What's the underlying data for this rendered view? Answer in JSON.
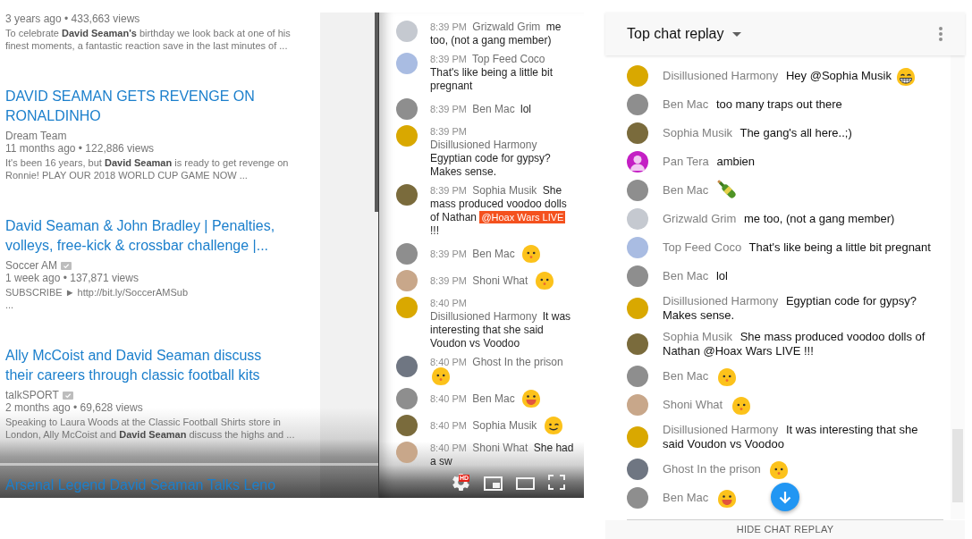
{
  "video_frame": {
    "results": [
      {
        "meta": "3 years ago • 433,663 views",
        "description": [
          "To celebrate **David Seaman's** birthday we look back at one of his",
          "finest moments, a fantastic reaction save in the last minutes of ..."
        ]
      },
      {
        "title": "DAVID SEAMAN GETS REVENGE ON RONALDINHO",
        "channel": "Dream Team",
        "verified": false,
        "meta": "11 months ago • 122,886 views",
        "description": [
          "It's been 16 years, but **David Seaman** is ready to get revenge on",
          "Ronnie! PLAY OUR 2018 WORLD CUP GAME NOW ..."
        ]
      },
      {
        "title": "David Seaman & John Bradley | Penalties, volleys, free-kick & crossbar challenge |...",
        "channel": "Soccer AM",
        "verified": true,
        "meta": "1 week ago • 137,871 views",
        "description": [
          "SUBSCRIBE ► http://bit.ly/SoccerAMSub",
          "..."
        ]
      },
      {
        "title": "Ally McCoist and David Seaman discuss their careers through classic football kits",
        "channel": "talkSPORT",
        "verified": true,
        "meta": "2 months ago • 69,628 views",
        "description": [
          "Speaking to Laura Woods at the Classic Football Shirts store in",
          "London, Ally McCoist and **David Seaman** discuss the highs and ..."
        ]
      },
      {
        "title": "Arsenal Legend David Seaman Talks Leno"
      }
    ],
    "chat": {
      "messages": [
        {
          "time": "8:39 PM",
          "author": "Grizwald Grim",
          "avatar": {
            "kind": "picture",
            "color": "#c5c9d0"
          },
          "segments": [
            {
              "kind": "text",
              "text": "me too, (not a gang member)"
            }
          ]
        },
        {
          "time": "8:39 PM",
          "author": "Top Feed Coco",
          "avatar": {
            "kind": "picture",
            "color": "#a9bce2"
          },
          "segments": [
            {
              "kind": "text",
              "text": "That's like being a little bit pregnant"
            }
          ]
        },
        {
          "time": "8:39 PM",
          "author": "Ben Mac",
          "avatar": {
            "kind": "picture",
            "color": "#8e8e8e"
          },
          "segments": [
            {
              "kind": "text",
              "text": "lol"
            }
          ]
        },
        {
          "time": "8:39 PM",
          "author": "Disillusioned Harmony",
          "avatar": {
            "kind": "picture",
            "color": "#d9a800"
          },
          "segments": [
            {
              "kind": "text",
              "text": "Egyptian code for gypsy? Makes sense."
            }
          ]
        },
        {
          "time": "8:39 PM",
          "author": "Sophia Musik",
          "avatar": {
            "kind": "picture",
            "color": "#7a6b3c"
          },
          "segments": [
            {
              "kind": "text",
              "text": "She mass produced voodoo dolls of Nathan"
            },
            {
              "kind": "mention",
              "text": "@Hoax Wars LIVE"
            },
            {
              "kind": "text",
              "text": "!!!"
            }
          ]
        },
        {
          "time": "8:39 PM",
          "author": "Ben Mac",
          "avatar": {
            "kind": "picture",
            "color": "#8e8e8e"
          },
          "segments": [
            {
              "kind": "hushed"
            }
          ]
        },
        {
          "time": "8:39 PM",
          "author": "Shoni What",
          "avatar": {
            "kind": "picture",
            "color": "#c8a78a"
          },
          "segments": [
            {
              "kind": "hushed"
            }
          ]
        },
        {
          "time": "8:40 PM",
          "author": "Disillusioned Harmony",
          "avatar": {
            "kind": "picture",
            "color": "#d9a800"
          },
          "segments": [
            {
              "kind": "text",
              "text": "It was interesting that she said Voudon vs Voodoo"
            }
          ]
        },
        {
          "time": "8:40 PM",
          "author": "Ghost In the prison",
          "avatar": {
            "kind": "picture",
            "color": "#6f7682"
          },
          "segments": [
            {
              "kind": "hushed"
            }
          ]
        },
        {
          "time": "8:40 PM",
          "author": "Ben Mac",
          "avatar": {
            "kind": "picture",
            "color": "#8e8e8e"
          },
          "segments": [
            {
              "kind": "smile"
            }
          ]
        },
        {
          "time": "8:40 PM",
          "author": "Sophia Musik",
          "avatar": {
            "kind": "picture",
            "color": "#7a6b3c"
          },
          "segments": [
            {
              "kind": "wink"
            }
          ]
        },
        {
          "time": "8:40 PM",
          "author": "Shoni What",
          "avatar": {
            "kind": "picture",
            "color": "#c8a78a"
          },
          "segments": [
            {
              "kind": "text",
              "text": "She had a sw"
            }
          ]
        }
      ]
    },
    "player": {
      "hd_badge": "HD"
    }
  },
  "chat_panel": {
    "title": "Top chat replay",
    "messages": [
      {
        "author": "Disillusioned Harmony",
        "avatar": {
          "kind": "picture",
          "color": "#d9a800"
        },
        "segments": [
          {
            "kind": "text",
            "text": "Hey @Sophia Musik"
          },
          {
            "kind": "grin"
          }
        ]
      },
      {
        "author": "Ben Mac",
        "avatar": {
          "kind": "picture",
          "color": "#8e8e8e"
        },
        "segments": [
          {
            "kind": "text",
            "text": "too many traps out there"
          }
        ]
      },
      {
        "author": "Sophia Musik",
        "avatar": {
          "kind": "picture",
          "color": "#7a6b3c"
        },
        "segments": [
          {
            "kind": "text",
            "text": "The gang's all here..;)"
          }
        ]
      },
      {
        "author": "Pan Tera",
        "avatar": {
          "kind": "silhouette",
          "color": "#c41fc4"
        },
        "segments": [
          {
            "kind": "text",
            "text": "ambien"
          }
        ]
      },
      {
        "author": "Ben Mac",
        "avatar": {
          "kind": "picture",
          "color": "#8e8e8e"
        },
        "segments": [
          {
            "kind": "bottle"
          }
        ]
      },
      {
        "author": "Grizwald Grim",
        "avatar": {
          "kind": "picture",
          "color": "#c5c9d0"
        },
        "segments": [
          {
            "kind": "text",
            "text": "me too, (not a gang member)"
          }
        ]
      },
      {
        "author": "Top Feed Coco",
        "avatar": {
          "kind": "picture",
          "color": "#a9bce2"
        },
        "segments": [
          {
            "kind": "text",
            "text": "That's like being a little bit pregnant"
          }
        ]
      },
      {
        "author": "Ben Mac",
        "avatar": {
          "kind": "picture",
          "color": "#8e8e8e"
        },
        "segments": [
          {
            "kind": "text",
            "text": "lol"
          }
        ]
      },
      {
        "author": "Disillusioned Harmony",
        "avatar": {
          "kind": "picture",
          "color": "#d9a800"
        },
        "segments": [
          {
            "kind": "text",
            "text": "Egyptian code for gypsy? Makes sense."
          }
        ]
      },
      {
        "author": "Sophia Musik",
        "avatar": {
          "kind": "picture",
          "color": "#7a6b3c"
        },
        "segments": [
          {
            "kind": "text",
            "text": "She mass produced voodoo dolls of Nathan @Hoax Wars LIVE !!!"
          }
        ]
      },
      {
        "author": "Ben Mac",
        "avatar": {
          "kind": "picture",
          "color": "#8e8e8e"
        },
        "segments": [
          {
            "kind": "hushed"
          }
        ]
      },
      {
        "author": "Shoni What",
        "avatar": {
          "kind": "picture",
          "color": "#c8a78a"
        },
        "segments": [
          {
            "kind": "hushed"
          }
        ]
      },
      {
        "author": "Disillusioned Harmony",
        "avatar": {
          "kind": "picture",
          "color": "#d9a800"
        },
        "segments": [
          {
            "kind": "text",
            "text": "It was interesting that she said Voudon vs Voodoo"
          }
        ]
      },
      {
        "author": "Ghost In the prison",
        "avatar": {
          "kind": "picture",
          "color": "#6f7682"
        },
        "segments": [
          {
            "kind": "hushed"
          }
        ]
      },
      {
        "author": "Ben Mac",
        "avatar": {
          "kind": "picture",
          "color": "#8e8e8e"
        },
        "segments": [
          {
            "kind": "smile"
          }
        ]
      }
    ],
    "footer_button": "HIDE CHAT REPLAY"
  }
}
